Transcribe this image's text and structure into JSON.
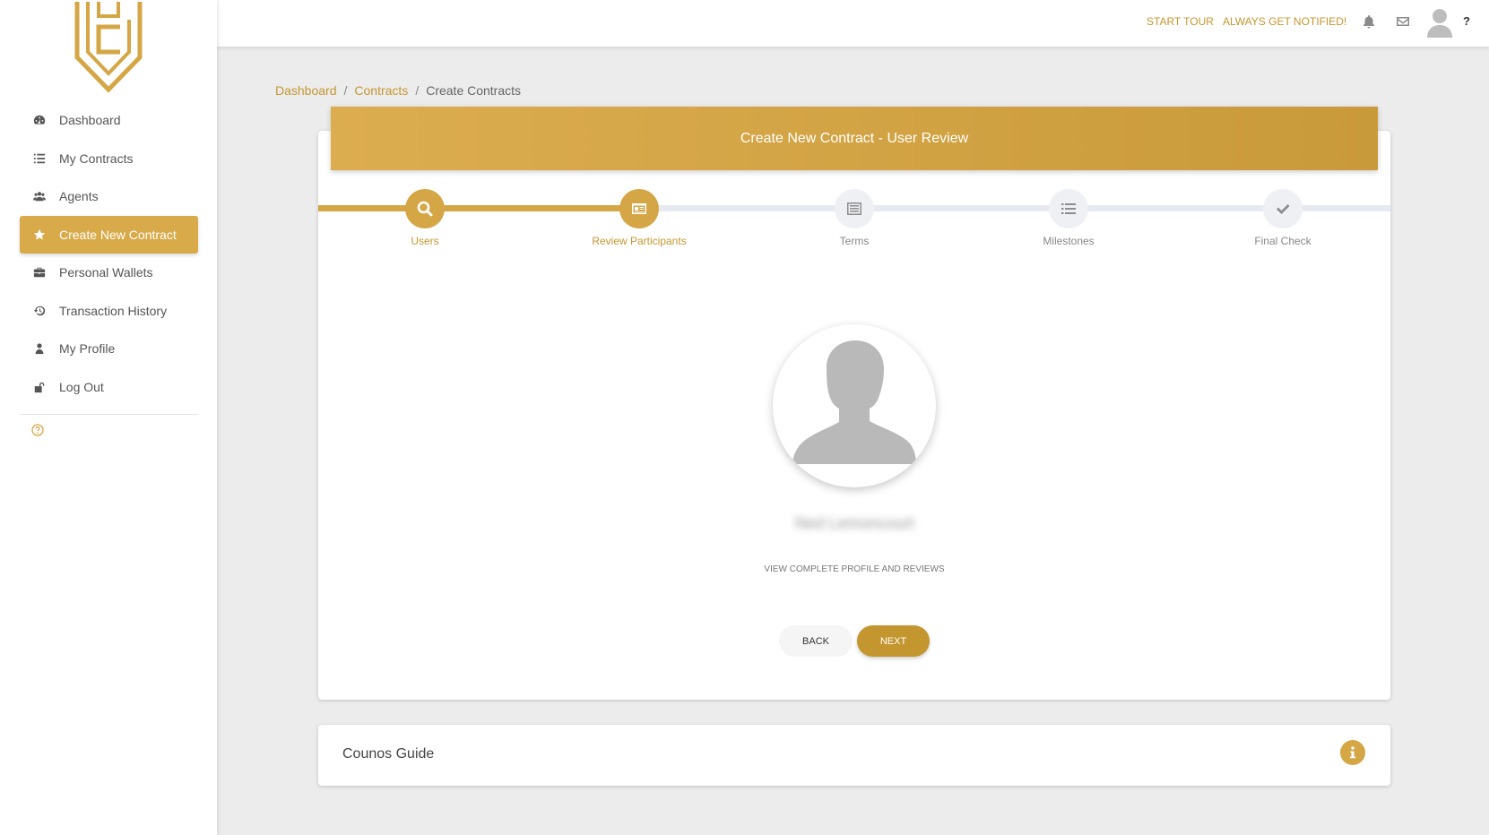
{
  "topbar": {
    "start_tour": "START TOUR",
    "always_notified": "ALWAYS GET NOTIFIED!",
    "help": "?"
  },
  "sidebar": {
    "items": [
      {
        "label": "Dashboard",
        "icon": "dashboard-icon"
      },
      {
        "label": "My Contracts",
        "icon": "list-icon"
      },
      {
        "label": "Agents",
        "icon": "users-icon"
      },
      {
        "label": "Create New Contract",
        "icon": "star-icon",
        "active": true
      },
      {
        "label": "Personal Wallets",
        "icon": "briefcase-icon"
      },
      {
        "label": "Transaction History",
        "icon": "history-icon"
      },
      {
        "label": "My Profile",
        "icon": "user-icon"
      },
      {
        "label": "Log Out",
        "icon": "unlock-icon"
      }
    ]
  },
  "breadcrumb": {
    "items": [
      "Dashboard",
      "Contracts",
      "Create Contracts"
    ],
    "separator": "/"
  },
  "card": {
    "title": "Create New Contract - User Review"
  },
  "stepper": {
    "steps": [
      {
        "label": "Users",
        "icon": "search-icon",
        "active": true
      },
      {
        "label": "Review Participants",
        "icon": "id-card-icon",
        "active": true
      },
      {
        "label": "Terms",
        "icon": "list-alt-icon",
        "active": false
      },
      {
        "label": "Milestones",
        "icon": "list-icon",
        "active": false
      },
      {
        "label": "Final Check",
        "icon": "check-icon",
        "active": false
      }
    ]
  },
  "profile": {
    "name": "Ned Lemoncourt",
    "view_link": "VIEW COMPLETE PROFILE AND REVIEWS"
  },
  "buttons": {
    "back": "BACK",
    "next": "NEXT"
  },
  "guide": {
    "title": "Counos Guide"
  },
  "colors": {
    "accent": "#d5a646",
    "accent_dark": "#c4962f",
    "background": "#ececec",
    "inactive_step": "#eef0f4"
  }
}
